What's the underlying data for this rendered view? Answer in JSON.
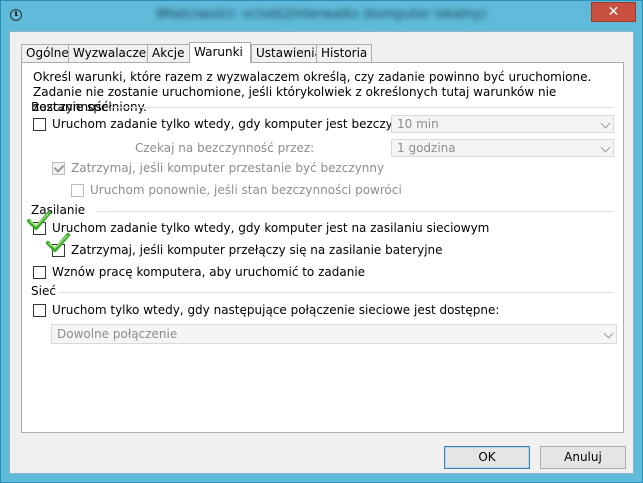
{
  "window": {
    "title": "Właściwości: vclseb2interwaiks (komputer lokalny)",
    "close_label": "✕"
  },
  "tabs": [
    {
      "label": "Ogólne"
    },
    {
      "label": "Wyzwalacze"
    },
    {
      "label": "Akcje"
    },
    {
      "label": "Warunki"
    },
    {
      "label": "Ustawienia"
    },
    {
      "label": "Historia"
    }
  ],
  "active_tab": "Warunki",
  "conditions": {
    "description": "Określ warunki, które razem z wyzwalaczem określą, czy zadanie powinno być uruchomione. Zadanie nie zostanie uruchomione, jeśli którykolwiek z określonych tutaj warunków nie zostanie spełniony.",
    "idle": {
      "group_label": "Bezczynność",
      "start_only_if_idle": {
        "label": "Uruchom zadanie tylko wtedy, gdy komputer jest bezczynny",
        "checked": false
      },
      "idle_duration": {
        "value": "10 min"
      },
      "wait_label": "Czekaj na bezczynność przez:",
      "wait_duration": {
        "value": "1 godzina"
      },
      "stop_if_not_idle": {
        "label": "Zatrzymaj, jeśli komputer przestanie być bezczynny",
        "checked": true
      },
      "restart_if_idle": {
        "label": "Uruchom ponownie, jeśli stan bezczynności powróci",
        "checked": false
      }
    },
    "power": {
      "group_label": "Zasilanie",
      "start_only_on_ac": {
        "label": "Uruchom zadanie tylko wtedy, gdy komputer jest na zasilaniu sieciowym",
        "checked": true
      },
      "stop_on_battery": {
        "label": "Zatrzymaj, jeśli komputer przełączy się na zasilanie bateryjne",
        "checked": true
      },
      "wake_to_run": {
        "label": "Wznów pracę komputera, aby uruchomić to zadanie",
        "checked": false
      }
    },
    "network": {
      "group_label": "Sieć",
      "start_only_if_network": {
        "label": "Uruchom tylko wtedy, gdy następujące połączenie sieciowe jest dostępne:",
        "checked": false
      },
      "connection": {
        "value": "Dowolne połączenie"
      }
    }
  },
  "buttons": {
    "ok": "OK",
    "cancel": "Anuluj"
  },
  "colors": {
    "title_bar": "#5fbbd9",
    "close_button": "#c7503e",
    "checkmark_green": "#3aa82a"
  }
}
